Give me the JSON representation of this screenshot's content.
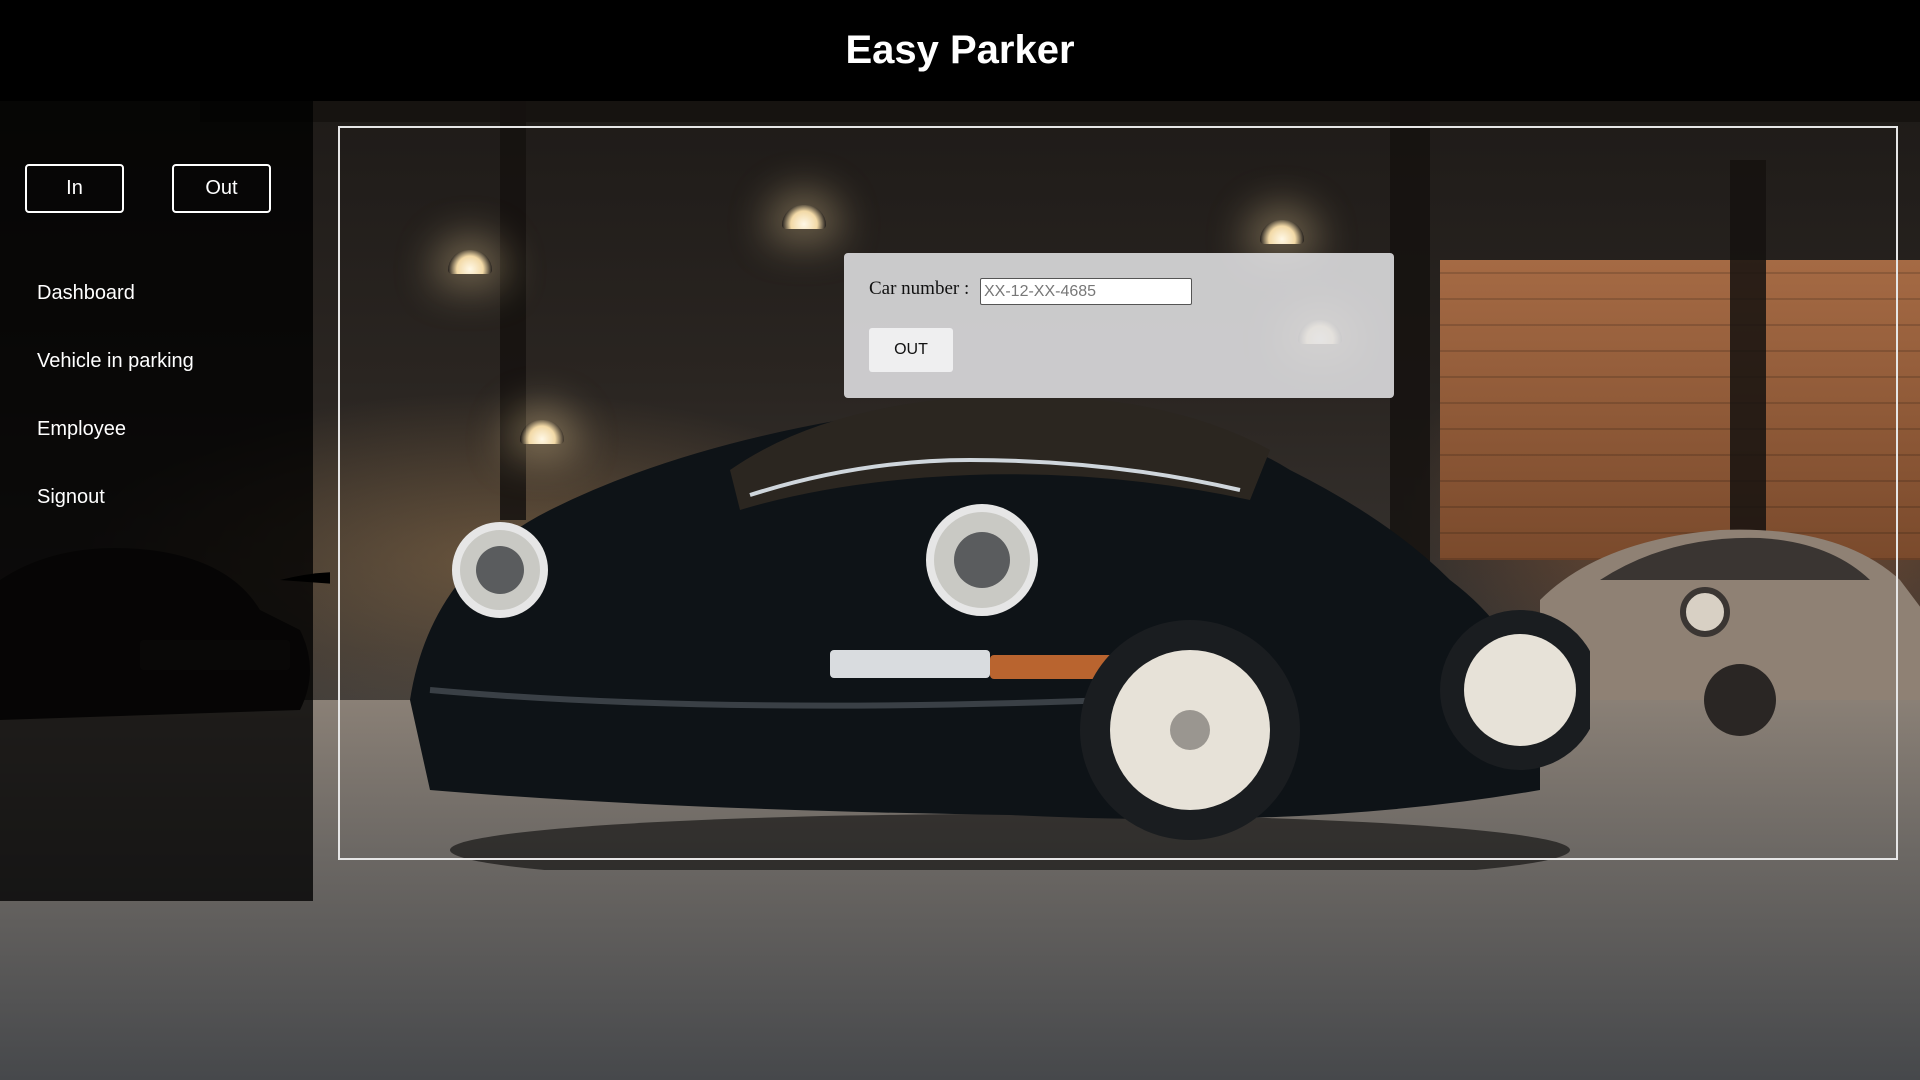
{
  "app": {
    "title": "Easy Parker"
  },
  "sidebar": {
    "mode_buttons": [
      {
        "label": "In"
      },
      {
        "label": "Out"
      }
    ],
    "items": [
      {
        "label": "Dashboard"
      },
      {
        "label": "Vehicle in parking"
      },
      {
        "label": "Employee"
      },
      {
        "label": "Signout"
      }
    ]
  },
  "form": {
    "car_number_label": "Car number :",
    "car_number_value": "",
    "car_number_placeholder": "XX-12-XX-4685",
    "submit_label": "OUT"
  },
  "colors": {
    "header_bg": "#000000",
    "sidebar_bg": "rgba(0,0,0,0.78)",
    "panel_bg": "rgba(225,225,228,0.88)",
    "text_light": "#ffffff"
  },
  "icons": {
    "background": "parking-garage-car-photo"
  }
}
